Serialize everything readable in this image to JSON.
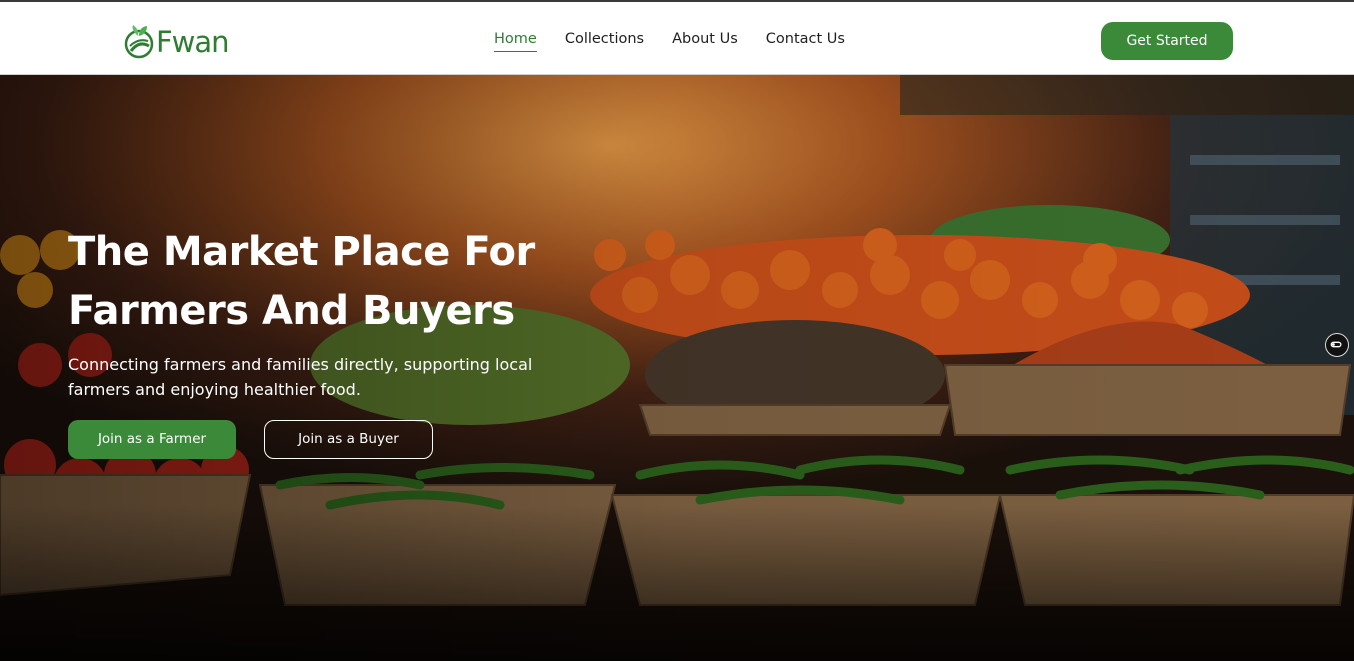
{
  "brand": {
    "name": "Fwan",
    "color": "#2e7d32"
  },
  "nav": {
    "items": [
      {
        "label": "Home",
        "active": true
      },
      {
        "label": "Collections",
        "active": false
      },
      {
        "label": "About Us",
        "active": false
      },
      {
        "label": "Contact Us",
        "active": false
      }
    ],
    "cta_label": "Get Started"
  },
  "hero": {
    "title_line1": "The Market Place For",
    "title_line2": "Farmers And Buyers",
    "subtitle": "Connecting farmers and families directly, supporting local farmers and enjoying healthier food.",
    "primary_button": "Join as a Farmer",
    "secondary_button": "Join as a Buyer",
    "background": "market-baskets-of-produce-photo"
  },
  "side_widget": {
    "icon": "toggle-switch-icon"
  },
  "colors": {
    "accent": "#3a8a3a",
    "text_dark": "#1f1f1f",
    "white": "#ffffff"
  }
}
